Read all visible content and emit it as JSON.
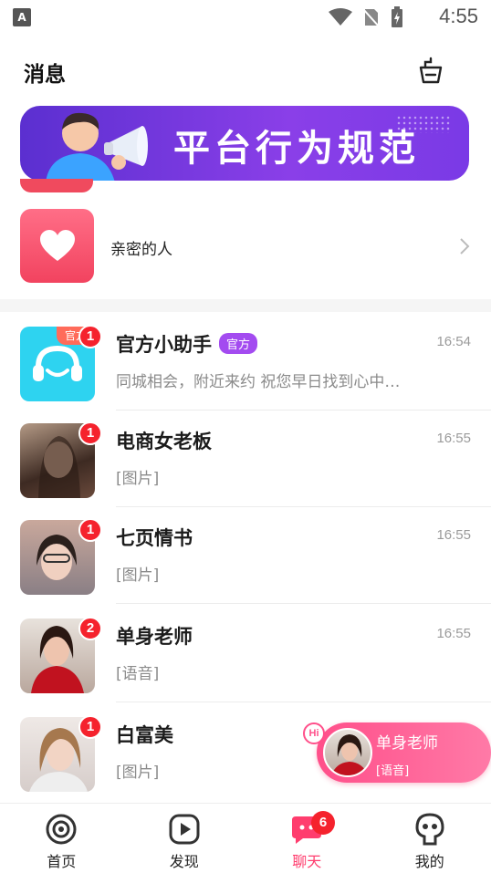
{
  "status_bar": {
    "app_badge": "A",
    "time": "4:55",
    "icons": [
      "wifi-icon",
      "no-sim-icon",
      "battery-charging-icon"
    ]
  },
  "header": {
    "title": "消息",
    "action_icon": "clean-basket-icon"
  },
  "banner": {
    "text": "平台行为规范"
  },
  "intimate": {
    "label": "亲密的人"
  },
  "messages": [
    {
      "name": "官方小助手",
      "tag": "官方",
      "corner": "官方",
      "preview": "同城相会，附近来约 祝您早日找到心中…",
      "time": "16:54",
      "badge": "1"
    },
    {
      "name": "电商女老板",
      "preview": "[图片]",
      "time": "16:55",
      "badge": "1"
    },
    {
      "name": "七页情书",
      "preview": "[图片]",
      "time": "16:55",
      "badge": "1"
    },
    {
      "name": "单身老师",
      "preview": "[语音]",
      "time": "16:55",
      "badge": "2"
    },
    {
      "name": "白富美",
      "preview": "[图片]",
      "time": "",
      "badge": "1"
    }
  ],
  "float_bubble": {
    "hi": "Hi",
    "name": "单身老师",
    "sub": "[语音]"
  },
  "nav": {
    "items": [
      {
        "label": "首页",
        "icon": "home-icon"
      },
      {
        "label": "发现",
        "icon": "play-icon"
      },
      {
        "label": "聊天",
        "icon": "chat-icon",
        "badge": "6",
        "active": true
      },
      {
        "label": "我的",
        "icon": "profile-icon"
      }
    ]
  },
  "colors": {
    "accent": "#ff3d6e",
    "banner": "#7a3ae6",
    "badge": "#f5222d",
    "official_tag": "#a34bf0"
  }
}
